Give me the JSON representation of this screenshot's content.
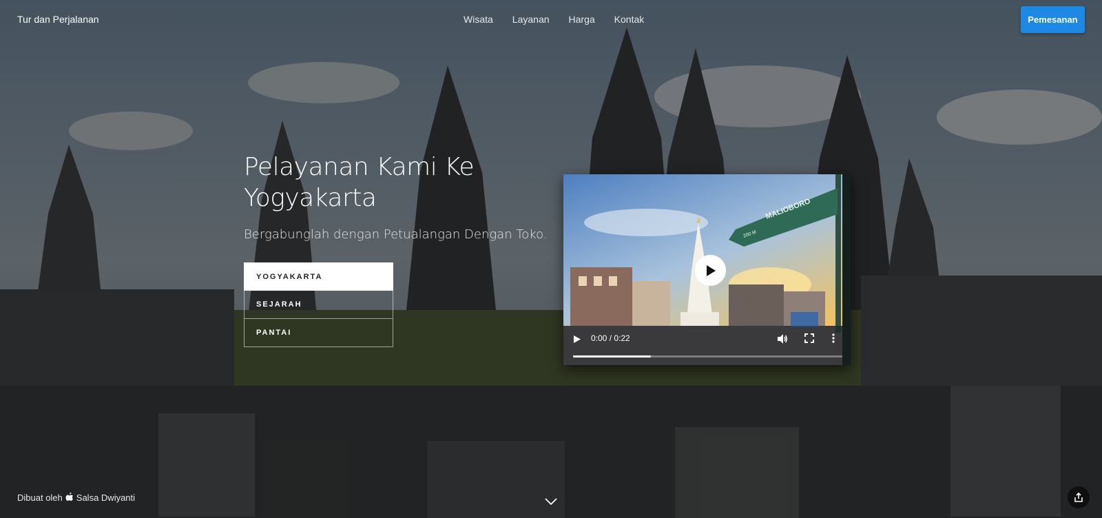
{
  "header": {
    "brand": "Tur dan Perjalanan",
    "nav": [
      "Wisata",
      "Layanan",
      "Harga",
      "Kontak"
    ],
    "cta_label": "Pemesanan"
  },
  "hero": {
    "title": "Pelayanan Kami Ke Yogyakarta",
    "subtitle": "Bergabunglah dengan Petualangan Dengan Toko."
  },
  "tabs": [
    {
      "label": "YOGYAKARTA",
      "active": true
    },
    {
      "label": "SEJARAH",
      "active": false
    },
    {
      "label": "PANTAI",
      "active": false
    }
  ],
  "video": {
    "time": "0:00 / 0:22",
    "progress": 0.29,
    "sign_text": "MALIOBORO",
    "sign_distance": "200 M"
  },
  "footer": {
    "credit_prefix": "Dibuat oleh",
    "credit_name": "Salsa Dwiyanti"
  },
  "colors": {
    "accent": "#1e88e5",
    "overlay": "rgba(0,0,0,0.45)"
  },
  "icons": {
    "video_play": "play-icon",
    "volume": "volume-icon",
    "fullscreen": "fullscreen-icon",
    "more": "more-vertical-icon",
    "scroll": "chevron-down-icon",
    "share": "share-icon",
    "credit_logo": "apple-icon"
  }
}
